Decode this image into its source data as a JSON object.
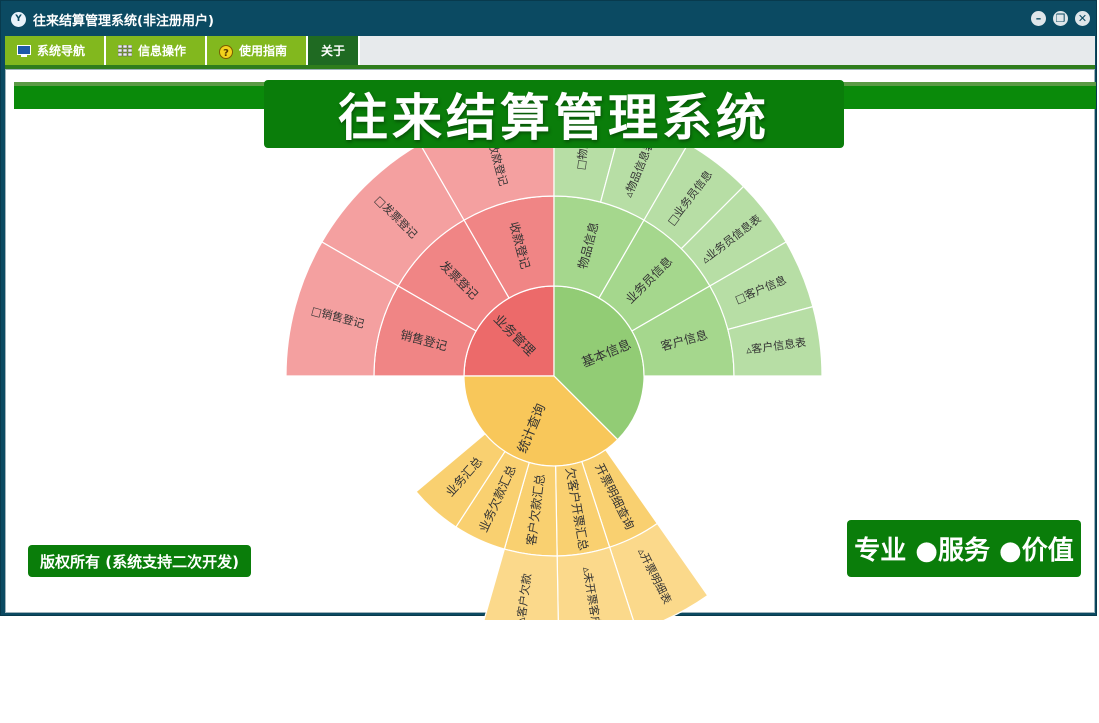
{
  "window": {
    "title": "往来结算管理系统(非注册用户)",
    "app_icon": "Y",
    "controls": [
      "minimize-icon",
      "restore-icon",
      "close-icon"
    ]
  },
  "menu": {
    "items": [
      {
        "label": "系统导航",
        "icon": "monitor-icon"
      },
      {
        "label": "信息操作",
        "icon": "grid-icon"
      },
      {
        "label": "使用指南",
        "icon": "help-icon"
      },
      {
        "label": "关于",
        "icon": ""
      }
    ],
    "active": 3
  },
  "banner": {
    "title": "往来结算管理系统"
  },
  "footer": {
    "copyright": "版权所有 (系统支持二次开发)",
    "slogan": "专业 ●服务 ●价值"
  },
  "colors": {
    "frame": "#0b4a62",
    "menu_green": "#82b81e",
    "banner_green": "#0a7d0a",
    "red_inner": "#ec6a6a",
    "red_outer": "#f4a0a0",
    "green_inner": "#92cc75",
    "green_outer": "#b7dea5",
    "yellow_inner": "#f8c75a",
    "yellow_outer": "#fbd98b"
  },
  "sunburst": {
    "inner": [
      {
        "label": "业务管理",
        "group": "red",
        "start": 270,
        "end": 360
      },
      {
        "label": "基本信息",
        "group": "green",
        "start": 0,
        "end": 135
      },
      {
        "label": "统计查询",
        "group": "yellow",
        "start": 135,
        "end": 270
      }
    ],
    "middle": [
      {
        "label": "收款登记",
        "group": "red",
        "start": 330,
        "end": 360
      },
      {
        "label": "发票登记",
        "group": "red",
        "start": 300,
        "end": 330
      },
      {
        "label": "销售登记",
        "group": "red",
        "start": 270,
        "end": 300
      },
      {
        "label": "物品信息",
        "group": "green",
        "start": 0,
        "end": 30
      },
      {
        "label": "业务员信息",
        "group": "green",
        "start": 30,
        "end": 60
      },
      {
        "label": "客户信息",
        "group": "green",
        "start": 60,
        "end": 90
      },
      {
        "label": "开票明细查询",
        "group": "yellow",
        "start": 145,
        "end": 162
      },
      {
        "label": "欠客户开票汇总",
        "group": "yellow",
        "start": 162,
        "end": 179
      },
      {
        "label": "客户欠款汇总",
        "group": "yellow",
        "start": 179,
        "end": 196
      },
      {
        "label": "业务欠款汇总",
        "group": "yellow",
        "start": 196,
        "end": 213
      },
      {
        "label": "业务汇总",
        "group": "yellow",
        "start": 213,
        "end": 230
      }
    ],
    "outer": [
      {
        "label": "□收款登记",
        "group": "red",
        "start": 330,
        "end": 360
      },
      {
        "label": "□发票登记",
        "group": "red",
        "start": 300,
        "end": 330
      },
      {
        "label": "□销售登记",
        "group": "red",
        "start": 270,
        "end": 300
      },
      {
        "label": "□物品",
        "group": "green",
        "start": 0,
        "end": 15
      },
      {
        "label": "▵物品信息表",
        "group": "green",
        "start": 15,
        "end": 30
      },
      {
        "label": "□业务员信息",
        "group": "green",
        "start": 30,
        "end": 45
      },
      {
        "label": "▵业务员信息表",
        "group": "green",
        "start": 45,
        "end": 60
      },
      {
        "label": "□客户信息",
        "group": "green",
        "start": 60,
        "end": 75
      },
      {
        "label": "▵客户信息表",
        "group": "green",
        "start": 75,
        "end": 90
      },
      {
        "label": "▵开票明细表",
        "group": "yellow",
        "start": 145,
        "end": 162
      },
      {
        "label": "▵未开票客户",
        "group": "yellow",
        "start": 162,
        "end": 179
      },
      {
        "label": "▵客户欠款",
        "group": "yellow",
        "start": 179,
        "end": 196
      }
    ]
  }
}
